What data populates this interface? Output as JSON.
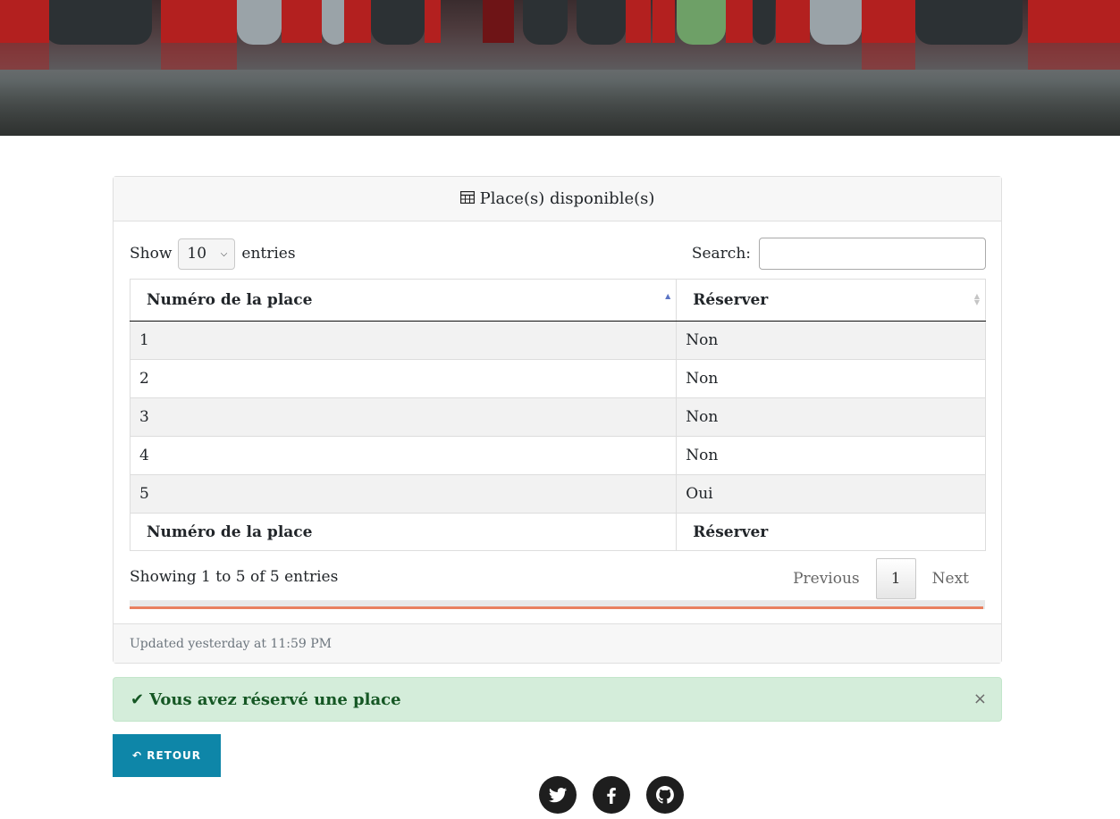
{
  "card": {
    "title": "Place(s) disponible(s)",
    "footer": "Updated yesterday at 11:59 PM"
  },
  "table_controls": {
    "show_label": "Show",
    "length_value": "10",
    "entries_label": "entries",
    "search_label": "Search:",
    "search_value": ""
  },
  "table": {
    "columns": [
      "Numéro de la place",
      "Réserver"
    ],
    "rows": [
      [
        "1",
        "Non"
      ],
      [
        "2",
        "Non"
      ],
      [
        "3",
        "Non"
      ],
      [
        "4",
        "Non"
      ],
      [
        "5",
        "Oui"
      ]
    ]
  },
  "pagination": {
    "info": "Showing 1 to 5 of 5 entries",
    "previous": "Previous",
    "current": "1",
    "next": "Next"
  },
  "alert": {
    "message": "Vous avez réservé une place",
    "close": "×"
  },
  "back_button": {
    "label": "↶ RETOUR"
  },
  "social": [
    "twitter-icon",
    "facebook-icon",
    "github-icon"
  ],
  "colors": {
    "alert_bg": "#d4edda",
    "alert_text": "#155724",
    "button": "#0e86a8"
  }
}
